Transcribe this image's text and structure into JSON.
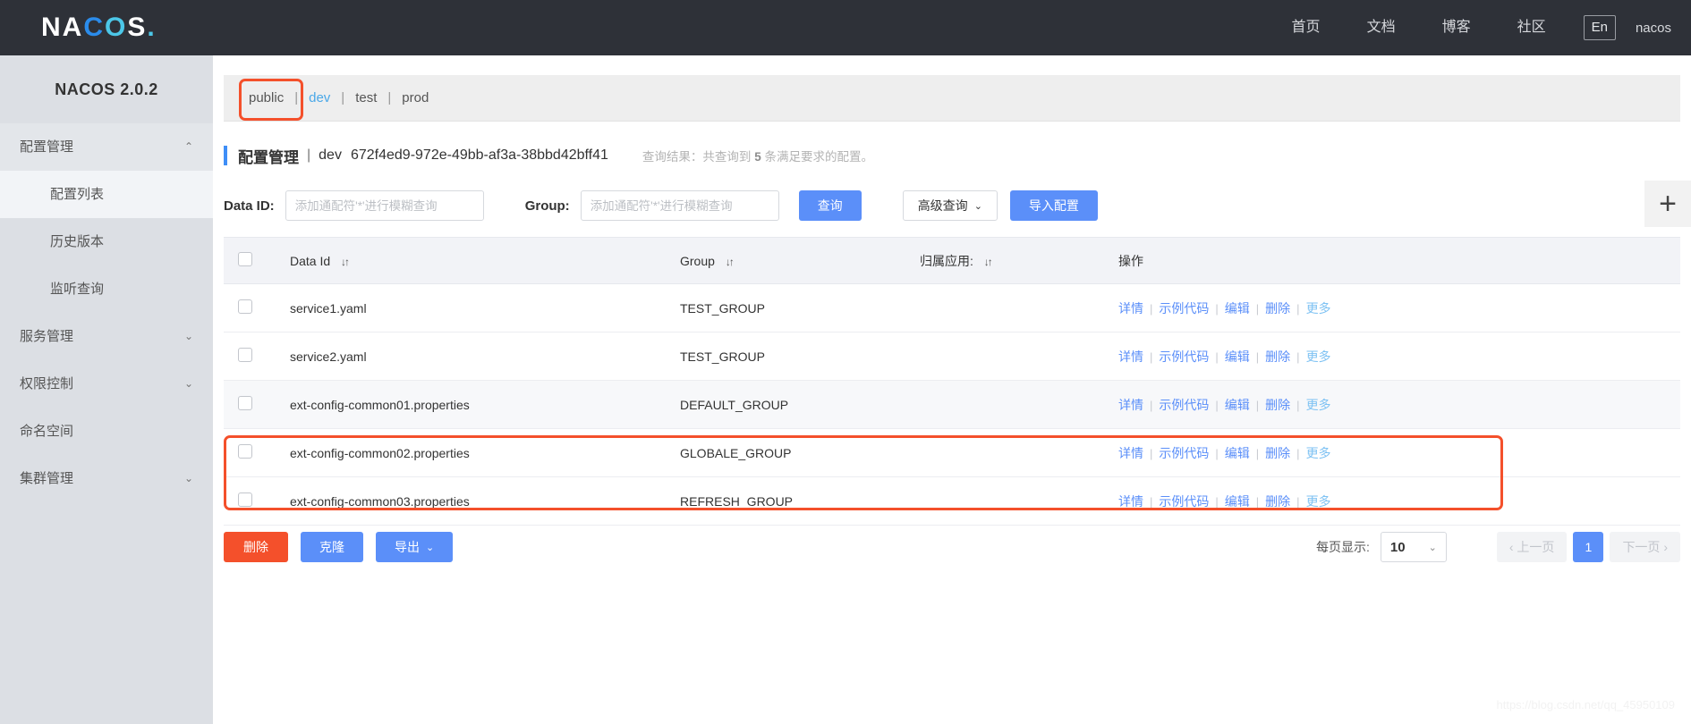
{
  "topbar": {
    "logo": {
      "part1": "NA",
      "part2": "C",
      "part3": "O",
      "part4": "S",
      "dot": "."
    },
    "nav": [
      {
        "label": "首页",
        "name": "nav-home"
      },
      {
        "label": "文档",
        "name": "nav-docs"
      },
      {
        "label": "博客",
        "name": "nav-blog"
      },
      {
        "label": "社区",
        "name": "nav-community"
      }
    ],
    "language": "En",
    "user": "nacos"
  },
  "sidebar": {
    "version": "NACOS 2.0.2",
    "items": [
      {
        "label": "配置管理",
        "caret": "⌃",
        "type": "group",
        "expanded": true
      },
      {
        "label": "配置列表",
        "type": "sub",
        "active": true
      },
      {
        "label": "历史版本",
        "type": "sub",
        "active": false
      },
      {
        "label": "监听查询",
        "type": "sub",
        "active": false
      },
      {
        "label": "服务管理",
        "caret": "⌄",
        "type": "group",
        "expanded": false
      },
      {
        "label": "权限控制",
        "caret": "⌄",
        "type": "group",
        "expanded": false
      },
      {
        "label": "命名空间",
        "caret": "",
        "type": "group",
        "expanded": false
      },
      {
        "label": "集群管理",
        "caret": "⌄",
        "type": "group",
        "expanded": false
      }
    ]
  },
  "namespaces": {
    "tabs": [
      {
        "label": "public",
        "active": false
      },
      {
        "label": "dev",
        "active": true
      },
      {
        "label": "test",
        "active": false
      },
      {
        "label": "prod",
        "active": false
      }
    ],
    "separator": "|"
  },
  "header": {
    "title": "配置管理",
    "separator": "|",
    "namespace_name": "dev",
    "namespace_id": "672f4ed9-972e-49bb-af3a-38bbd42bff41",
    "result_prefix": "查询结果：共查询到",
    "result_count": "5",
    "result_suffix": "条满足要求的配置。"
  },
  "search": {
    "dataid_label": "Data ID:",
    "dataid_value": "",
    "dataid_placeholder": "添加通配符'*'进行模糊查询",
    "group_label": "Group:",
    "group_value": "",
    "group_placeholder": "添加通配符'*'进行模糊查询",
    "query_button": "查询",
    "advanced_button": "高级查询",
    "advanced_caret": "⌄",
    "import_button": "导入配置",
    "add_icon": "+"
  },
  "table": {
    "columns": [
      {
        "label": "Data Id",
        "sortable": true,
        "sort_icon": "↓↑"
      },
      {
        "label": "Group",
        "sortable": true,
        "sort_icon": "↓↑"
      },
      {
        "label": "归属应用:",
        "sortable": true,
        "sort_icon": "↓↑"
      },
      {
        "label": "操作",
        "sortable": false,
        "sort_icon": ""
      }
    ],
    "actions": [
      {
        "label": "详情",
        "dim": false
      },
      {
        "label": "示例代码",
        "dim": false
      },
      {
        "label": "编辑",
        "dim": false
      },
      {
        "label": "删除",
        "dim": false
      },
      {
        "label": "更多",
        "dim": true
      }
    ],
    "action_separator": "|",
    "rows": [
      {
        "data_id": "service1.yaml",
        "group": "TEST_GROUP",
        "app": "",
        "checked": false,
        "shaded": false
      },
      {
        "data_id": "service2.yaml",
        "group": "TEST_GROUP",
        "app": "",
        "checked": false,
        "shaded": false
      },
      {
        "data_id": "ext-config-common01.properties",
        "group": "DEFAULT_GROUP",
        "app": "",
        "checked": false,
        "shaded": true
      },
      {
        "data_id": "ext-config-common02.properties",
        "group": "GLOBALE_GROUP",
        "app": "",
        "checked": false,
        "shaded": false
      },
      {
        "data_id": "ext-config-common03.properties",
        "group": "REFRESH_GROUP",
        "app": "",
        "checked": false,
        "shaded": false
      }
    ]
  },
  "footer": {
    "delete_button": "删除",
    "clone_button": "克隆",
    "export_button": "导出",
    "export_caret": "⌄",
    "page_size_label": "每页显示:",
    "page_size_value": "10",
    "page_size_caret": "⌄",
    "prev_page": "‹ 上一页",
    "current_page": "1",
    "next_page": "下一页 ›"
  },
  "watermark": "https://blog.csdn.net/qq_45950109",
  "colors": {
    "topbar_bg": "#2e3138",
    "sidebar_bg": "#dcdfe4",
    "primary": "#5b8ff9",
    "danger": "#f4502b",
    "link": "#5b8ff9",
    "active_tab": "#4aa8e8",
    "annotation": "#f4502b"
  }
}
